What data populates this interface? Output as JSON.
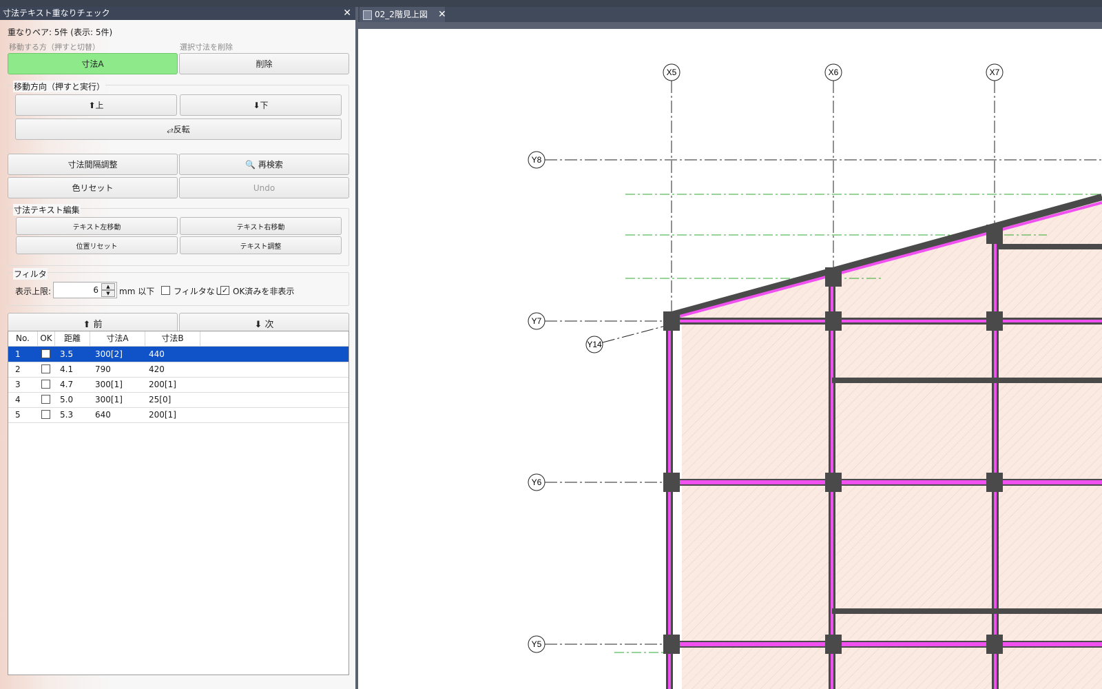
{
  "panel": {
    "title": "寸法テキスト重なりチェック",
    "summary": "重なりペア: 5件 (表示: 5件)",
    "move_side_label": "移動する方（押すと切替）",
    "delete_label": "選択寸法を削除",
    "btn_target": "寸法A",
    "btn_delete": "削除",
    "direction_group": "移動方向（押すと実行）",
    "btn_up": "⬆上",
    "btn_down": "⬇下",
    "btn_flip": "⥄反転",
    "btn_spacing": "寸法間隔調整",
    "btn_research": "🔍 再検索",
    "btn_color_reset": "色リセット",
    "btn_undo": "Undo",
    "edit_group": "寸法テキスト編集",
    "btn_text_left": "テキスト左移動",
    "btn_text_right": "テキスト右移動",
    "btn_pos_reset": "位置リセット",
    "btn_text_adjust": "テキスト調整",
    "filter_group": "フィルタ",
    "limit_label": "表示上限:",
    "limit_value": "6",
    "limit_unit": "mm 以下",
    "no_filter_label": "フィルタなし",
    "hide_ok_label": "OK済みを非表示",
    "btn_prev": "⬆ 前",
    "btn_next": "⬇ 次",
    "columns": [
      "No.",
      "OK",
      "距離",
      "寸法A",
      "寸法B"
    ],
    "rows": [
      {
        "no": "1",
        "dist": "3.5",
        "a": "300[2]",
        "b": "440"
      },
      {
        "no": "2",
        "dist": "4.1",
        "a": "790",
        "b": "420"
      },
      {
        "no": "3",
        "dist": "4.7",
        "a": "300[1]",
        "b": "200[1]"
      },
      {
        "no": "4",
        "dist": "5.0",
        "a": "300[1]",
        "b": "25[0]"
      },
      {
        "no": "5",
        "dist": "5.3",
        "a": "640",
        "b": "200[1]"
      }
    ]
  },
  "document": {
    "tab_title": "02_2階見上図",
    "grid_labels": {
      "x5": "X5",
      "x6": "X6",
      "x7": "X7",
      "y8": "Y8",
      "y7": "Y7",
      "y14": "Y14",
      "y6": "Y6",
      "y5": "Y5"
    },
    "colors": {
      "beam": "#f050f0",
      "slab": "#fbeae2",
      "column": "#4a4a4a",
      "grid_line": "#222222",
      "green_line": "#2fa82f"
    }
  }
}
